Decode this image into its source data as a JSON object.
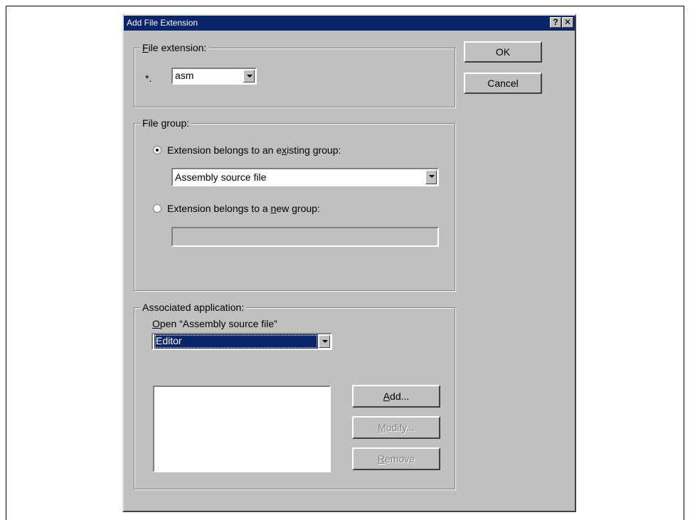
{
  "dialog": {
    "title": "Add File Extension",
    "help_label": "?",
    "close_label": "✕"
  },
  "buttons": {
    "ok": "OK",
    "cancel": "Cancel"
  },
  "file_extension": {
    "group_label_mnemonic": "F",
    "group_label_rest": "ile extension:",
    "prefix": "*.",
    "value": "asm"
  },
  "file_group": {
    "group_label": "File group:",
    "existing_pre": "Extension belongs to an e",
    "existing_mnemonic": "x",
    "existing_post": "isting group:",
    "existing_value": "Assembly source file",
    "new_pre": "Extension belongs to a ",
    "new_mnemonic": "n",
    "new_post": "ew group:",
    "new_value": "",
    "selected": "existing"
  },
  "associated": {
    "group_label": "Associated application:",
    "open_mnemonic": "O",
    "open_rest": "pen “Assembly source file”",
    "selected_app": "Editor",
    "apps": [],
    "add_mnemonic": "A",
    "add_rest": "dd...",
    "modify_mnemonic": "M",
    "modify_rest": "odify...",
    "remove_mnemonic": "R",
    "remove_rest": "emove"
  }
}
